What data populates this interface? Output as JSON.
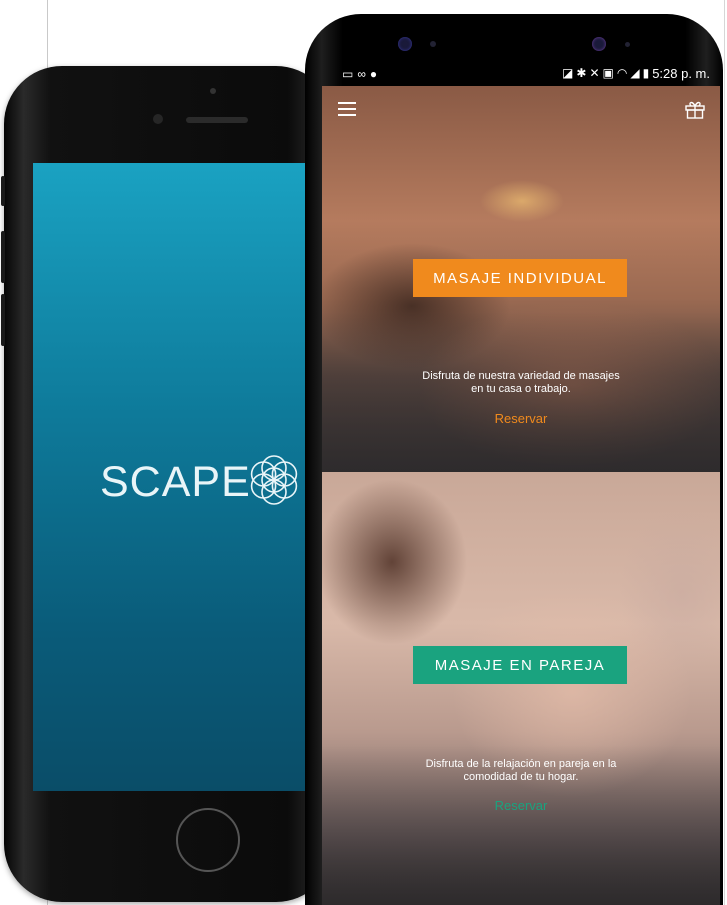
{
  "splash": {
    "logo_text": "SCAPE"
  },
  "status_bar": {
    "time": "5:28 p. m.",
    "left_icons": [
      "screen-icon",
      "voicemail-icon",
      "chat-icon"
    ],
    "right_icons": [
      "no-sim-icon",
      "bluetooth-icon",
      "mute-icon",
      "nfc-icon",
      "wifi-icon",
      "signal-icon",
      "battery-icon"
    ]
  },
  "top_bar": {
    "menu_icon": "hamburger-menu-icon",
    "gift_icon": "gift-icon"
  },
  "cards": [
    {
      "button_label": "MASAJE INDIVIDUAL",
      "description_line1": "Disfruta de nuestra variedad de masajes",
      "description_line2": "en tu casa o trabajo.",
      "reserve_label": "Reservar",
      "accent_color": "#f08a1d"
    },
    {
      "button_label": "MASAJE EN PAREJA",
      "description_line1": "Disfruta de la relajación en pareja en la",
      "description_line2": "comodidad de tu hogar.",
      "reserve_label": "Reservar",
      "accent_color": "#1aa37f"
    }
  ],
  "colors": {
    "splash_top": "#1aa2c2",
    "splash_bottom": "#0a4d68",
    "orange_accent": "#f08a1d",
    "green_accent": "#1aa37f"
  }
}
